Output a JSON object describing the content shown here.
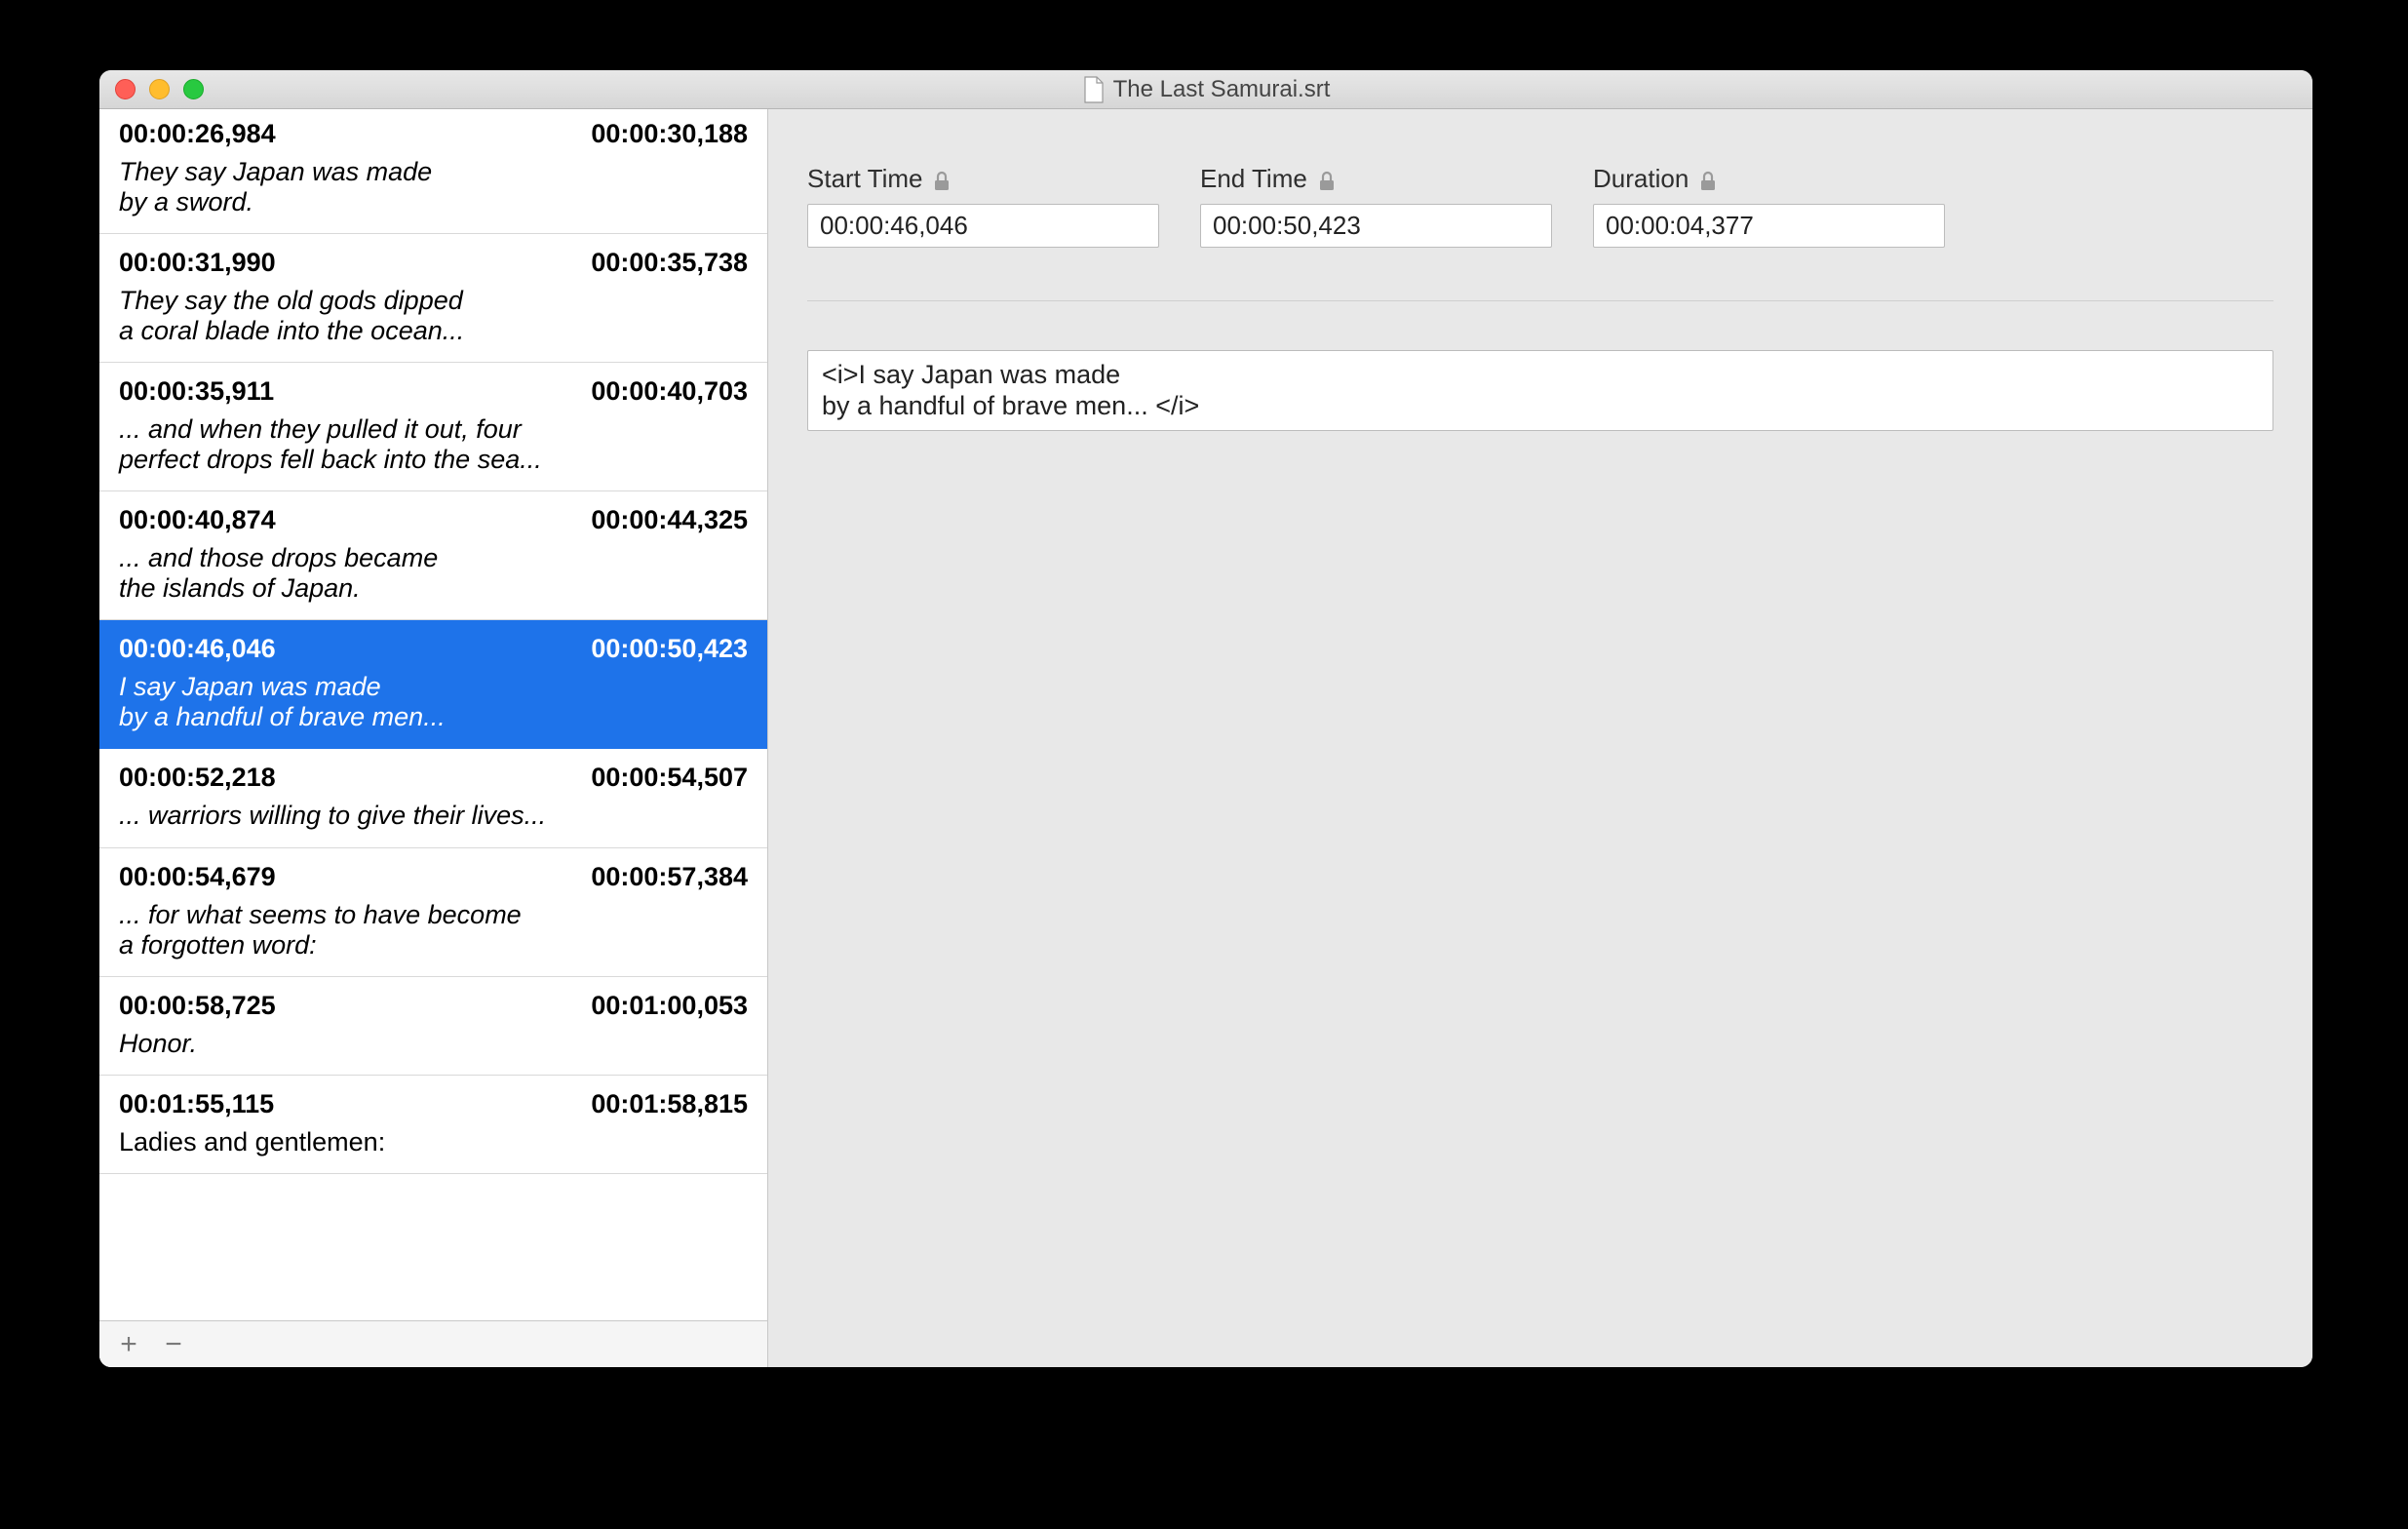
{
  "window": {
    "title": "The Last Samurai.srt"
  },
  "sidebar": {
    "items": [
      {
        "start": "00:00:26,984",
        "end": "00:00:30,188",
        "text": "They say Japan was made\nby a sword.",
        "italic": true
      },
      {
        "start": "00:00:31,990",
        "end": "00:00:35,738",
        "text": "They say the old gods dipped\na coral blade into the ocean...",
        "italic": true
      },
      {
        "start": "00:00:35,911",
        "end": "00:00:40,703",
        "text": "... and when they pulled it out, four\nperfect drops fell back into the sea...",
        "italic": true
      },
      {
        "start": "00:00:40,874",
        "end": "00:00:44,325",
        "text": "... and those drops became\nthe islands of Japan.",
        "italic": true
      },
      {
        "start": "00:00:46,046",
        "end": "00:00:50,423",
        "text": "I say Japan was made\nby a handful of brave men...",
        "italic": true,
        "selected": true
      },
      {
        "start": "00:00:52,218",
        "end": "00:00:54,507",
        "text": "... warriors willing to give their lives...",
        "italic": true
      },
      {
        "start": "00:00:54,679",
        "end": "00:00:57,384",
        "text": "... for what seems to have become\na forgotten word:",
        "italic": true
      },
      {
        "start": "00:00:58,725",
        "end": "00:01:00,053",
        "text": "Honor.",
        "italic": true
      },
      {
        "start": "00:01:55,115",
        "end": "00:01:58,815",
        "text": "Ladies and gentlemen:",
        "italic": false
      }
    ],
    "footer": {
      "add": "+",
      "remove": "−"
    }
  },
  "detail": {
    "labels": {
      "start": "Start Time",
      "end": "End Time",
      "duration": "Duration"
    },
    "values": {
      "start": "00:00:46,046",
      "end": "00:00:50,423",
      "duration": "00:00:04,377"
    },
    "text": "<i>I say Japan was made\nby a handful of brave men... </i>"
  }
}
